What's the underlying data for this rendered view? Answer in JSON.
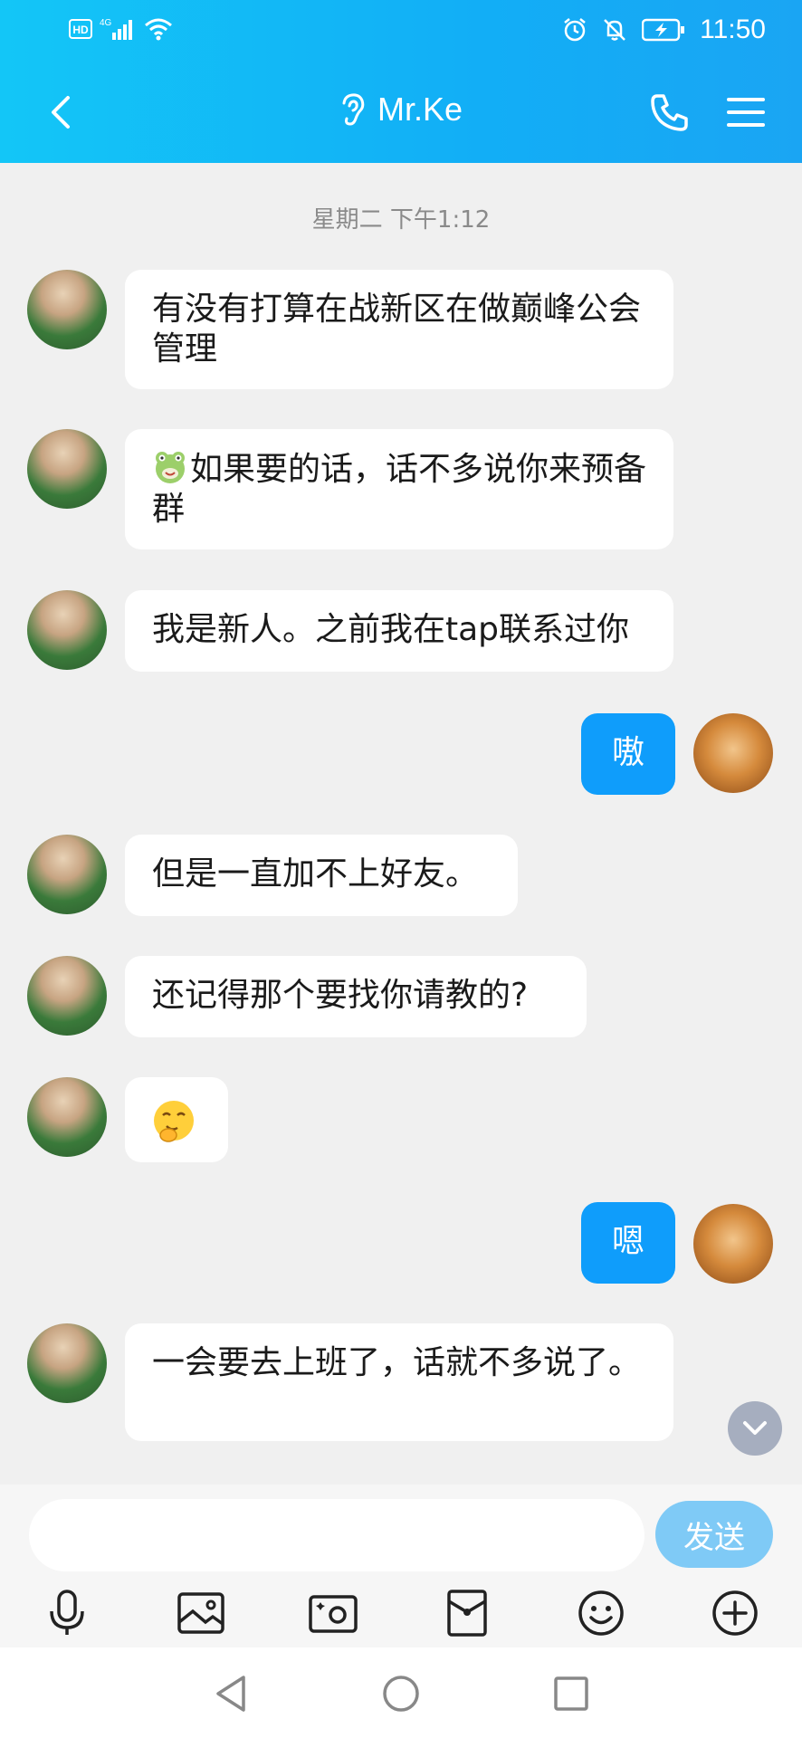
{
  "status_bar": {
    "left_icons": [
      "hd-icon",
      "4g-signal-icon",
      "wifi-icon"
    ],
    "right_icons": [
      "alarm-icon",
      "mute-icon",
      "battery-charging-icon"
    ],
    "time": "11:50",
    "hd_label": "HD",
    "network_label": "4G"
  },
  "header": {
    "title": "Mr.Ke",
    "back_icon": "back-icon",
    "listen_icon": "ear-icon",
    "call_icon": "phone-icon",
    "menu_icon": "menu-icon"
  },
  "chat": {
    "timestamp": "星期二 下午1:12",
    "messages": [
      {
        "side": "in",
        "text": "有没有打算在战新区在做巅峰公会管理"
      },
      {
        "side": "in",
        "text": "如果要的话，话不多说你来预备群",
        "emoji": "frog-emoji"
      },
      {
        "side": "in",
        "text": "我是新人。之前我在tap联系过你"
      },
      {
        "side": "out",
        "text": "嗷"
      },
      {
        "side": "in",
        "text": "但是一直加不上好友。"
      },
      {
        "side": "in",
        "text": "还记得那个要找你请教的?"
      },
      {
        "side": "in",
        "text": "",
        "emoji": "shy-laugh-emoji"
      },
      {
        "side": "out",
        "text": "嗯"
      },
      {
        "side": "in",
        "text": "一会要去上班了，话就不多说了。"
      }
    ]
  },
  "input": {
    "value": "",
    "placeholder": "",
    "send_label": "发送"
  },
  "toolbar": {
    "items": [
      "microphone-icon",
      "image-icon",
      "camera-icon",
      "red-packet-icon",
      "emoji-icon",
      "plus-icon"
    ]
  },
  "system_nav": [
    "back-triangle-icon",
    "home-circle-icon",
    "recents-square-icon"
  ]
}
